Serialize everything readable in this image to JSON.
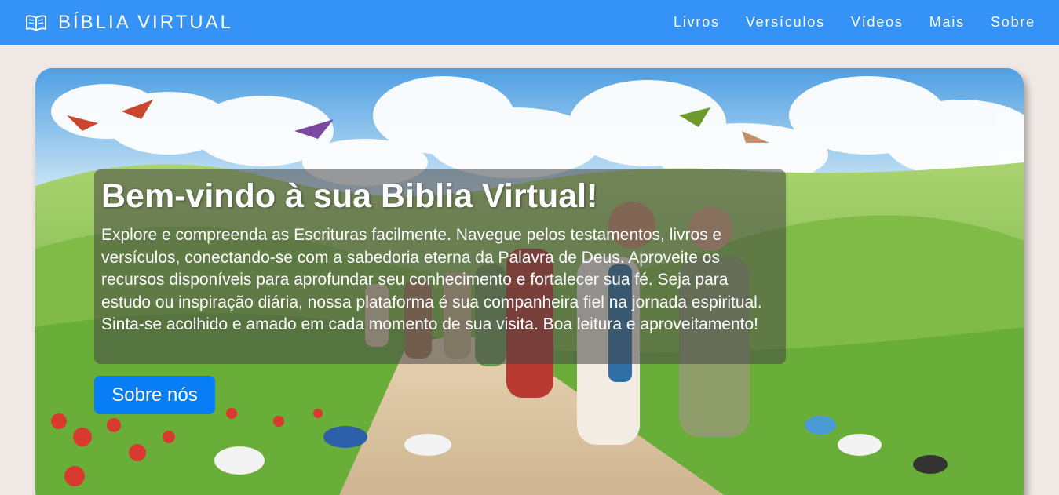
{
  "navbar": {
    "brand_icon": "open-book-icon",
    "brand_text": "BÍBLIA VIRTUAL",
    "links": [
      {
        "label": "Livros"
      },
      {
        "label": "Versículos"
      },
      {
        "label": "Vídeos"
      },
      {
        "label": "Mais"
      },
      {
        "label": "Sobre"
      }
    ],
    "background_color": "#3593f7"
  },
  "hero": {
    "title": "Bem-vindo à sua Biblia Virtual!",
    "text": "Explore e compreenda as Escrituras facilmente. Navegue pelos testamentos, livros e versículos, conectando-se com a sabedoria eterna da Palavra de Deus. Aproveite os recursos disponíveis para aprofundar seu conhecimento e fortalecer sua fé. Seja para estudo ou inspiração diária, nossa plataforma é sua companheira fiel na jornada espiritual. Sinta-se acolhido e amado em cada momento de sua visita. Boa leitura e aproveitamento!",
    "button_label": "Sobre nós",
    "button_color": "#087ef6",
    "image": "illustration-jesus-walking-with-people-and-birds-in-green-hills"
  },
  "page_background": "#f1e9e5"
}
